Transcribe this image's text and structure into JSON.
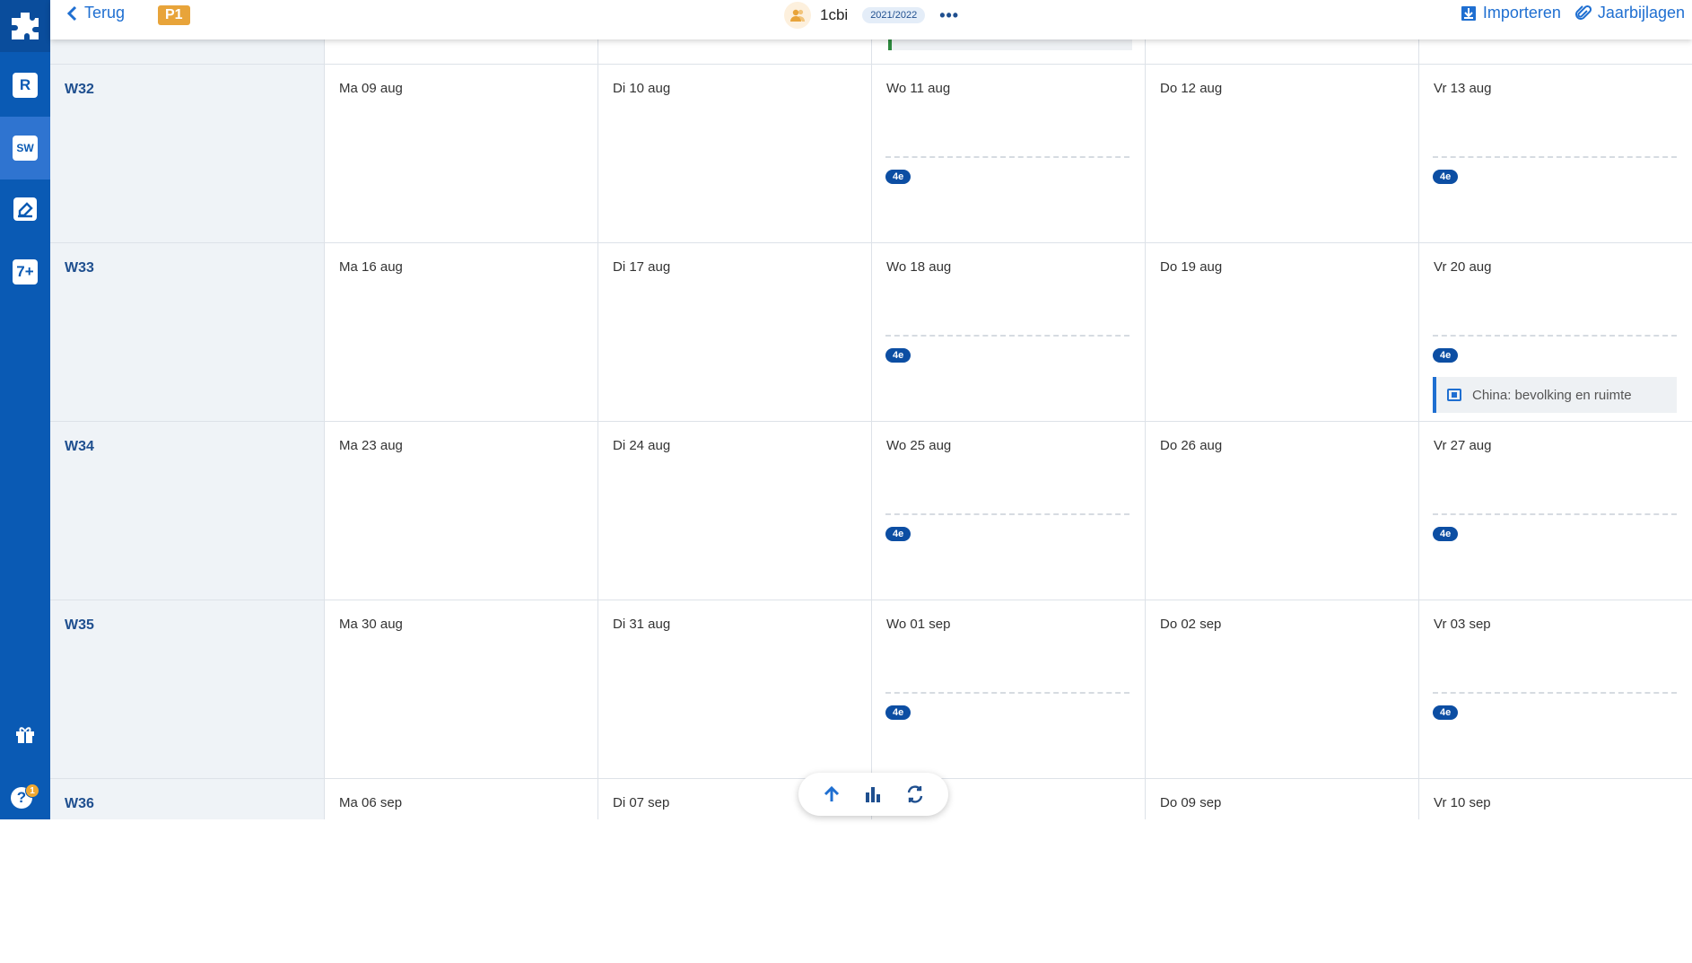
{
  "topbar": {
    "back_label": "Terug",
    "period_badge": "P1",
    "group_name": "1cbi",
    "school_year": "2021/2022",
    "more_label": "•••",
    "import_label": "Importeren",
    "attachments_label": "Jaarbijlagen"
  },
  "sidebar": {
    "items": [
      {
        "icon": "puzzle-logo-icon"
      },
      {
        "label": "R",
        "icon": "roster-icon"
      },
      {
        "label": "SW",
        "icon": "studywijzer-icon",
        "active": true
      },
      {
        "icon": "eraser-board-icon"
      },
      {
        "label": "7+",
        "icon": "grades-icon"
      },
      {
        "icon": "gift-icon"
      },
      {
        "icon": "help-icon",
        "badge": "1"
      }
    ]
  },
  "weeks": [
    {
      "label": "W32",
      "days": [
        {
          "label": "Ma 09 aug"
        },
        {
          "label": "Di 10 aug"
        },
        {
          "label": "Wo 11 aug",
          "level": "4e"
        },
        {
          "label": "Do 12 aug"
        },
        {
          "label": "Vr 13 aug",
          "level": "4e"
        }
      ]
    },
    {
      "label": "W33",
      "days": [
        {
          "label": "Ma 16 aug"
        },
        {
          "label": "Di 17 aug"
        },
        {
          "label": "Wo 18 aug",
          "level": "4e"
        },
        {
          "label": "Do 19 aug"
        },
        {
          "label": "Vr 20 aug",
          "level": "4e",
          "lesson": "China: bevolking en ruimte"
        }
      ]
    },
    {
      "label": "W34",
      "days": [
        {
          "label": "Ma 23 aug"
        },
        {
          "label": "Di 24 aug"
        },
        {
          "label": "Wo 25 aug",
          "level": "4e"
        },
        {
          "label": "Do 26 aug"
        },
        {
          "label": "Vr 27 aug",
          "level": "4e"
        }
      ]
    },
    {
      "label": "W35",
      "days": [
        {
          "label": "Ma 30 aug"
        },
        {
          "label": "Di 31 aug"
        },
        {
          "label": "Wo 01 sep",
          "level": "4e"
        },
        {
          "label": "Do 02 sep"
        },
        {
          "label": "Vr 03 sep",
          "level": "4e"
        }
      ]
    },
    {
      "label": "W36",
      "days": [
        {
          "label": "Ma 06 sep"
        },
        {
          "label": "Di 07 sep"
        },
        {
          "label": ""
        },
        {
          "label": "Do 09 sep"
        },
        {
          "label": "Vr 10 sep"
        }
      ]
    }
  ],
  "floating_toolbar": {
    "items": [
      {
        "icon": "arrow-up-icon"
      },
      {
        "icon": "bar-chart-icon"
      },
      {
        "icon": "sync-icon"
      }
    ]
  },
  "colors": {
    "rail": "#0a5ab4",
    "accent": "#1f6fd1",
    "badge_level": "#0c4ea3",
    "period_badge": "#e8a43a"
  }
}
